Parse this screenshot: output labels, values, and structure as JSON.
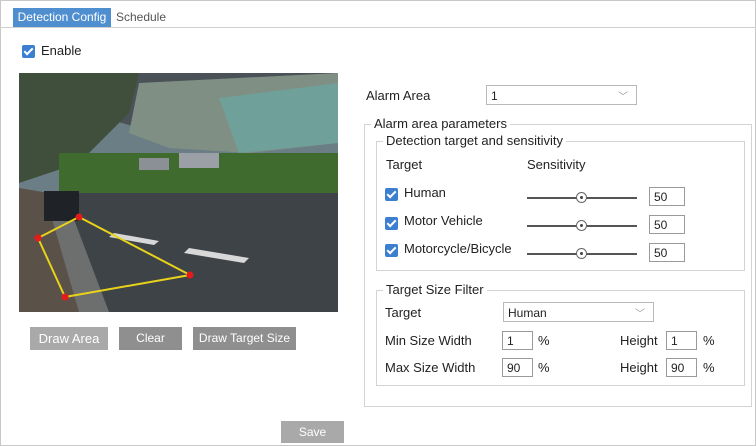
{
  "tabs": [
    {
      "label": "Detection Config",
      "active": true
    },
    {
      "label": "Schedule",
      "active": false
    }
  ],
  "enable": {
    "label": "Enable",
    "checked": true
  },
  "buttons": {
    "draw_area": "Draw Area",
    "clear": "Clear",
    "draw_target_size": "Draw Target Size",
    "save": "Save"
  },
  "alarm_area": {
    "label": "Alarm Area",
    "value": "1"
  },
  "alarm_params": {
    "legend": "Alarm area parameters"
  },
  "detection": {
    "legend": "Detection target and sensitivity",
    "col_target": "Target",
    "col_sensitivity": "Sensitivity",
    "rows": [
      {
        "label": "Human",
        "checked": true,
        "value": "50",
        "level": 0.5
      },
      {
        "label": "Motor Vehicle",
        "checked": true,
        "value": "50",
        "level": 0.5
      },
      {
        "label": "Motorcycle/Bicycle",
        "checked": true,
        "value": "50",
        "level": 0.5
      }
    ]
  },
  "size_filter": {
    "legend": "Target Size Filter",
    "target_label": "Target",
    "target_value": "Human",
    "min_width_label": "Min Size Width",
    "min_width": "1",
    "max_width_label": "Max Size Width",
    "max_width": "90",
    "height_label": "Height",
    "min_height": "1",
    "max_height": "90",
    "unit": "%"
  },
  "colors": {
    "accent": "#3c7fd1",
    "tab_active": "#4f8fcf",
    "polygon": "#e8d21a",
    "vertex": "#e31b1b"
  }
}
